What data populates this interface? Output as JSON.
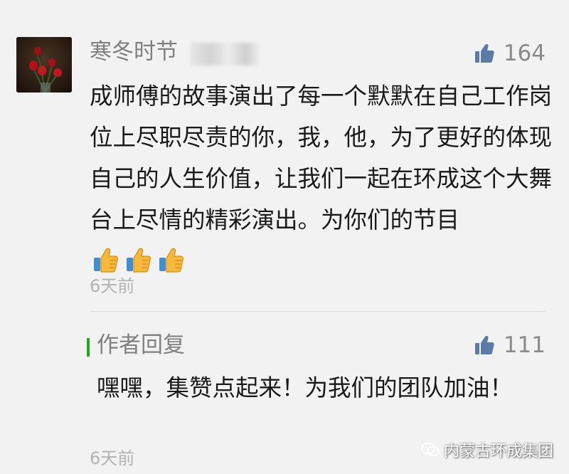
{
  "comment": {
    "username": "寒冬时节",
    "likes": "164",
    "text": "成师傅的故事演出了每一个默默在自己工作岗位上尽职尽责的你，我，他，为了更好的体现自己的人生价值，让我们一起在环成这个大舞台上尽情的精彩演出。为你们的节目",
    "emoji_names": [
      "thumbs-up-emoji",
      "thumbs-up-emoji",
      "thumbs-up-emoji"
    ],
    "time": "6天前"
  },
  "reply": {
    "label": "作者回复",
    "likes": "111",
    "text": "嘿嘿，集赞点起来！为我们的团队加油！",
    "time": "6天前"
  },
  "watermark": {
    "text": "内蒙古环成集团"
  },
  "colors": {
    "background": "#f2f2f2",
    "username": "#808080",
    "body_text": "#1a1a1a",
    "timestamp": "#b3b3b3",
    "like_icon": "#5a7ba8",
    "reply_accent": "#1aad19"
  },
  "icons": {
    "like": "thumbs-up-icon",
    "avatar": "red-roses-avatar",
    "watermark": "wechat-icon"
  }
}
